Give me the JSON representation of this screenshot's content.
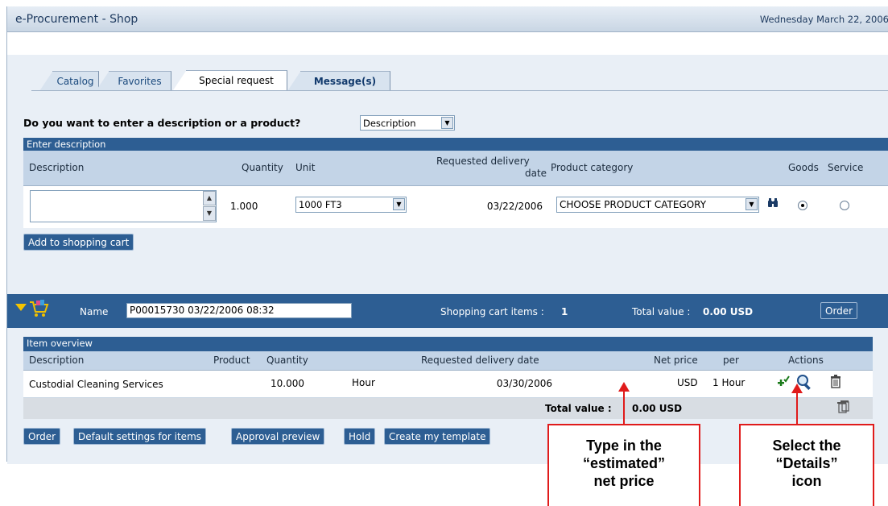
{
  "app_title": "e-Procurement - Shop",
  "date": "Wednesday  March 22, 2006",
  "tabs": [
    {
      "label": "Catalog"
    },
    {
      "label": "Favorites"
    },
    {
      "label": "Special request"
    },
    {
      "label": "Message(s)"
    }
  ],
  "question": "Do you want to enter a description or a product?",
  "entry_type": "Description",
  "enter_description": {
    "section_title": "Enter description",
    "headers": {
      "description": "Description",
      "quantity": "Quantity",
      "unit": "Unit",
      "req_date_line1": "Requested delivery",
      "req_date_line2": "date",
      "product_category": "Product category",
      "goods": "Goods",
      "service": "Service"
    },
    "description_value": "",
    "quantity": "1.000",
    "unit": "1000 FT3",
    "req_date": "03/22/2006",
    "product_category": "CHOOSE PRODUCT CATEGORY",
    "goods_selected": true,
    "add_button": "Add to shopping cart"
  },
  "cart": {
    "name_label": "Name",
    "name_value": "P00015730 03/22/2006 08:32",
    "items_label": "Shopping cart items :",
    "items_count": "1",
    "total_label": "Total value :",
    "total_value": "0.00 USD",
    "order_button": "Order"
  },
  "item_overview": {
    "section_title": "Item overview",
    "headers": {
      "description": "Description",
      "product": "Product",
      "quantity": "Quantity",
      "req_date": "Requested delivery date",
      "net_price": "Net price",
      "per": "per",
      "actions": "Actions"
    },
    "rows": [
      {
        "description": "Custodial Cleaning Services",
        "product": "",
        "quantity": "10.000",
        "unit": "Hour",
        "req_date": "03/30/2006",
        "net_price": "",
        "currency": "USD",
        "per": "1  Hour"
      }
    ],
    "total_label": "Total value :",
    "total_value": "0.00 USD"
  },
  "bottom_buttons": [
    {
      "label": "Order"
    },
    {
      "label": "Default settings for items"
    },
    {
      "label": "Approval preview"
    },
    {
      "label": "Hold"
    },
    {
      "label": "Create my template"
    }
  ],
  "callouts": {
    "price": [
      "Type in the",
      "“estimated”",
      "net price"
    ],
    "details": [
      "Select the",
      "“Details”",
      "icon"
    ]
  },
  "icons": {
    "binoculars": "binoculars-icon",
    "cart": "shopping-cart-icon",
    "add": "add-check-icon",
    "details": "magnifier-icon",
    "delete": "trash-icon"
  },
  "colors": {
    "header_blue": "#2d5e93",
    "light_blue": "#c3d4e7",
    "panel": "#e9eff6",
    "callout_red": "#e01b1b"
  }
}
